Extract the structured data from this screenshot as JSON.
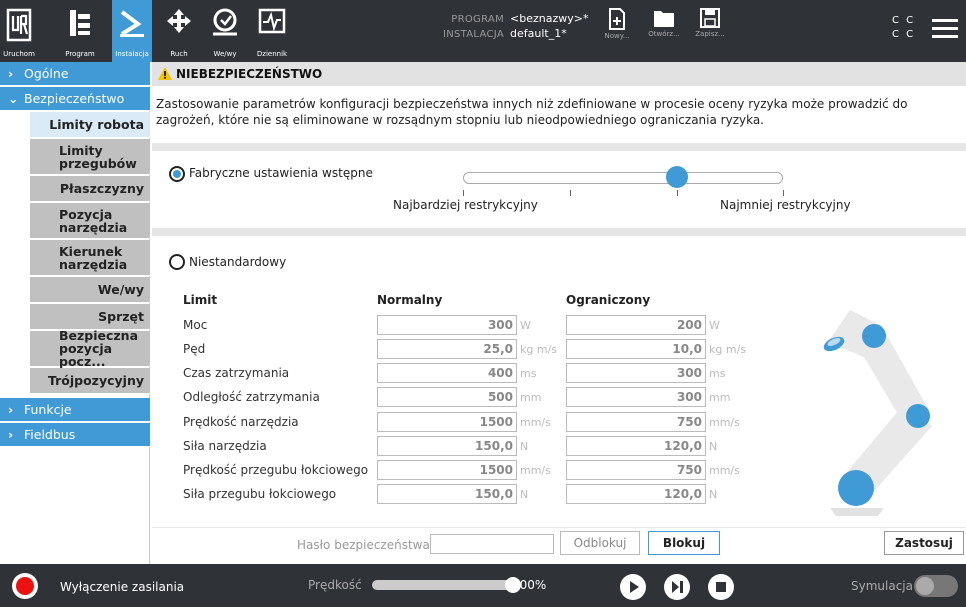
{
  "header": {
    "nav": [
      {
        "label": "Uruchom",
        "icon": "ur-logo-icon"
      },
      {
        "label": "Program",
        "icon": "program-icon"
      },
      {
        "label": "Instalacja",
        "icon": "installation-icon"
      },
      {
        "label": "Ruch",
        "icon": "move-icon"
      },
      {
        "label": "We/wy",
        "icon": "io-icon"
      },
      {
        "label": "Dziennik",
        "icon": "log-icon"
      }
    ],
    "program_key": "PROGRAM",
    "program_value": "<beznazwy>*",
    "install_key": "INSTALACJA",
    "install_value": "default_1*",
    "file_buttons": [
      {
        "label": "Nowy..."
      },
      {
        "label": "Otwórz..."
      },
      {
        "label": "Zapisz..."
      }
    ],
    "cc_top": "C C",
    "cc_bottom": "C C"
  },
  "sidebar": {
    "categories": [
      {
        "label": "Ogólne"
      },
      {
        "label": "Bezpieczeństwo"
      },
      {
        "label": "Funkcje"
      },
      {
        "label": "Fieldbus"
      }
    ],
    "items": [
      {
        "label": "Limity robota"
      },
      {
        "label": "Limity przegubów"
      },
      {
        "label": "Płaszczyzny"
      },
      {
        "label": "Pozycja narzędzia"
      },
      {
        "label": "Kierunek narzędzia"
      },
      {
        "label": "We/wy"
      },
      {
        "label": "Sprzęt"
      },
      {
        "label": "Bezpieczna pozycja pocz..."
      },
      {
        "label": "Trójpozycyjny"
      }
    ]
  },
  "main": {
    "warning_title": "NIEBEZPIECZEŃSTWO",
    "warning_text": "Zastosowanie parametrów konfiguracji bezpieczeństwa innych niż zdefiniowane w procesie oceny ryzyka może prowadzić do zagrożeń, które nie są eliminowane w rozsądnym stopniu lub nieodpowiedniego ograniczania ryzyka.",
    "factory_label": "Fabryczne ustawienia wstępne",
    "most_restrictive": "Najbardziej restrykcyjny",
    "least_restrictive": "Najmniej restrykcyjny",
    "custom_label": "Niestandardowy",
    "col_limit": "Limit",
    "col_normal": "Normalny",
    "col_reduced": "Ograniczony",
    "rows": [
      {
        "label": "Moc",
        "normal": "300",
        "reduced": "200",
        "unit": "W"
      },
      {
        "label": "Pęd",
        "normal": "25,0",
        "reduced": "10,0",
        "unit": "kg m/s"
      },
      {
        "label": "Czas zatrzymania",
        "normal": "400",
        "reduced": "300",
        "unit": "ms"
      },
      {
        "label": "Odległość zatrzymania",
        "normal": "500",
        "reduced": "300",
        "unit": "mm"
      },
      {
        "label": "Prędkość narzędzia",
        "normal": "1500",
        "reduced": "750",
        "unit": "mm/s"
      },
      {
        "label": "Siła narzędzia",
        "normal": "150,0",
        "reduced": "120,0",
        "unit": "N"
      },
      {
        "label": "Prędkość przegubu łokciowego",
        "normal": "1500",
        "reduced": "750",
        "unit": "mm/s"
      },
      {
        "label": "Siła przegubu łokciowego",
        "normal": "150,0",
        "reduced": "120,0",
        "unit": "N"
      }
    ],
    "password_label": "Hasło bezpieczeństwa",
    "password_value": "",
    "unlock_label": "Odblokuj",
    "lock_label": "Blokuj",
    "apply_label": "Zastosuj"
  },
  "footer": {
    "power_label": "Wyłączenie zasilania",
    "speed_label": "Prędkość",
    "speed_value": "100%",
    "speed_fraction": 1.0,
    "sim_label": "Symulacja"
  },
  "colors": {
    "accent": "#3f9ad6",
    "header_bg": "#2f3338",
    "warning": "#f5c400",
    "power": "#e11111"
  }
}
